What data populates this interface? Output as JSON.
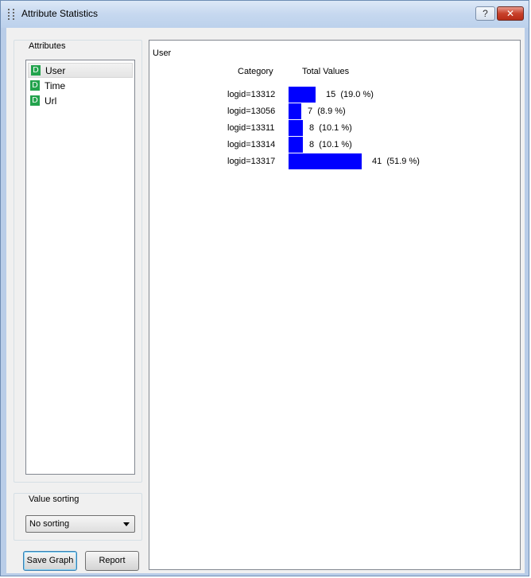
{
  "window": {
    "title": "Attribute Statistics",
    "help_glyph": "?",
    "close_glyph": "✕",
    "colors": {
      "titlebar": "#c6d8ef",
      "close": "#c8412b",
      "bar": "#0000ff",
      "badge": "#23a34d"
    }
  },
  "attributes": {
    "group_label": "Attributes",
    "items": [
      {
        "badge": "D",
        "label": "User",
        "selected": true
      },
      {
        "badge": "D",
        "label": "Time",
        "selected": false
      },
      {
        "badge": "D",
        "label": "Url",
        "selected": false
      }
    ]
  },
  "sorting": {
    "group_label": "Value sorting",
    "selected": "No sorting"
  },
  "buttons": {
    "save_graph": "Save Graph",
    "report": "Report"
  },
  "graph": {
    "title": "User",
    "col_category": "Category",
    "col_total": "Total Values"
  },
  "chart_data": {
    "type": "bar",
    "orientation": "horizontal",
    "categories": [
      "logid=13312",
      "logid=13056",
      "logid=13311",
      "logid=13314",
      "logid=13317"
    ],
    "values": [
      15,
      7,
      8,
      8,
      41
    ],
    "labels": [
      "15  (19.0 %)",
      "7  (8.9 %)",
      "8  (10.1 %)",
      "8  (10.1 %)",
      "41  (51.9 %)"
    ],
    "xlabel": "Total Values",
    "ylabel": "Category",
    "title": "User"
  }
}
